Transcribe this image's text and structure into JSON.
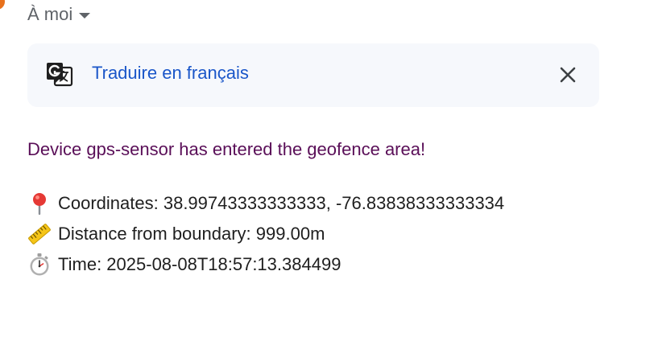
{
  "recipient": {
    "label": "À moi"
  },
  "translate_bar": {
    "link_text": "Traduire en français",
    "icon": "google-translate-icon",
    "close_icon": "close-icon"
  },
  "message": {
    "headline": "Device gps-sensor has entered the geofence area!",
    "lines": [
      {
        "icon": "round-pushpin-emoji",
        "text": "Coordinates: 38.99743333333333, -76.83838333333334"
      },
      {
        "icon": "straight-ruler-emoji",
        "text": "Distance from boundary: 999.00m"
      },
      {
        "icon": "stopwatch-emoji",
        "text": "Time: 2025-08-08T18:57:13.384499"
      }
    ]
  },
  "colors": {
    "headline": "#5a0f58",
    "link": "#1a56c9",
    "bar_background": "#f6f8fc",
    "avatar": "#e8711c"
  }
}
